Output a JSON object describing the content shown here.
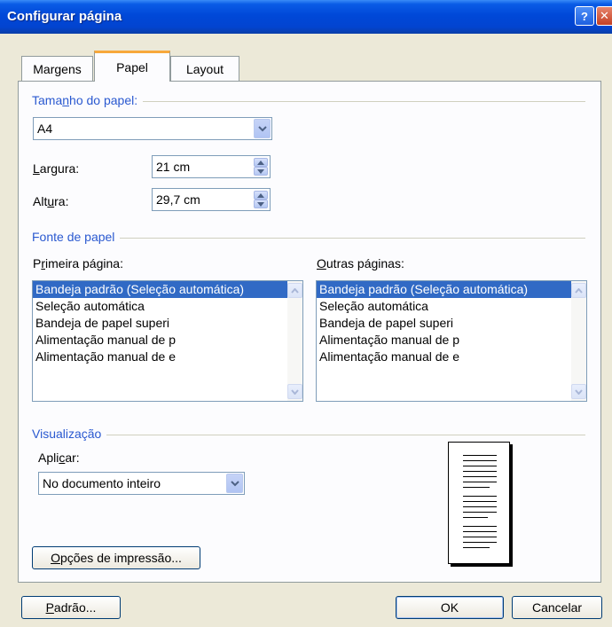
{
  "window": {
    "title": "Configurar página",
    "help_symbol": "?",
    "close_symbol": "✕"
  },
  "tabs": [
    {
      "label": "Margens"
    },
    {
      "label": "Papel",
      "active": true
    },
    {
      "label": "Layout"
    }
  ],
  "paper_size": {
    "group_label_pre": "Tama",
    "group_label_acc": "n",
    "group_label_post": "ho do papel:",
    "value": "A4",
    "width_label_pre": "",
    "width_label_acc": "L",
    "width_label_post": "argura:",
    "width_value": "21 cm",
    "height_label_pre": "Alt",
    "height_label_acc": "u",
    "height_label_post": "ra:",
    "height_value": "29,7 cm"
  },
  "paper_source": {
    "group_label": "Fonte de papel",
    "first_page_label_pre": "P",
    "first_page_label_acc": "r",
    "first_page_label_post": "imeira página:",
    "other_pages_label_pre": "",
    "other_pages_label_acc": "O",
    "other_pages_label_post": "utras páginas:",
    "items": [
      "Bandeja padrão (Seleção automática)",
      "Seleção automática",
      "Bandeja de papel superi",
      "Alimentação manual de p",
      "Alimentação manual de e"
    ],
    "selected_index": 0
  },
  "preview": {
    "group_label": "Visualização",
    "apply_label_pre": "Apli",
    "apply_label_acc": "c",
    "apply_label_post": "ar:",
    "apply_value": "No documento inteiro"
  },
  "buttons": {
    "print_options_acc": "O",
    "print_options_post": "pções de impressão...",
    "default_acc": "P",
    "default_post": "adrão...",
    "ok": "OK",
    "cancel": "Cancelar"
  }
}
